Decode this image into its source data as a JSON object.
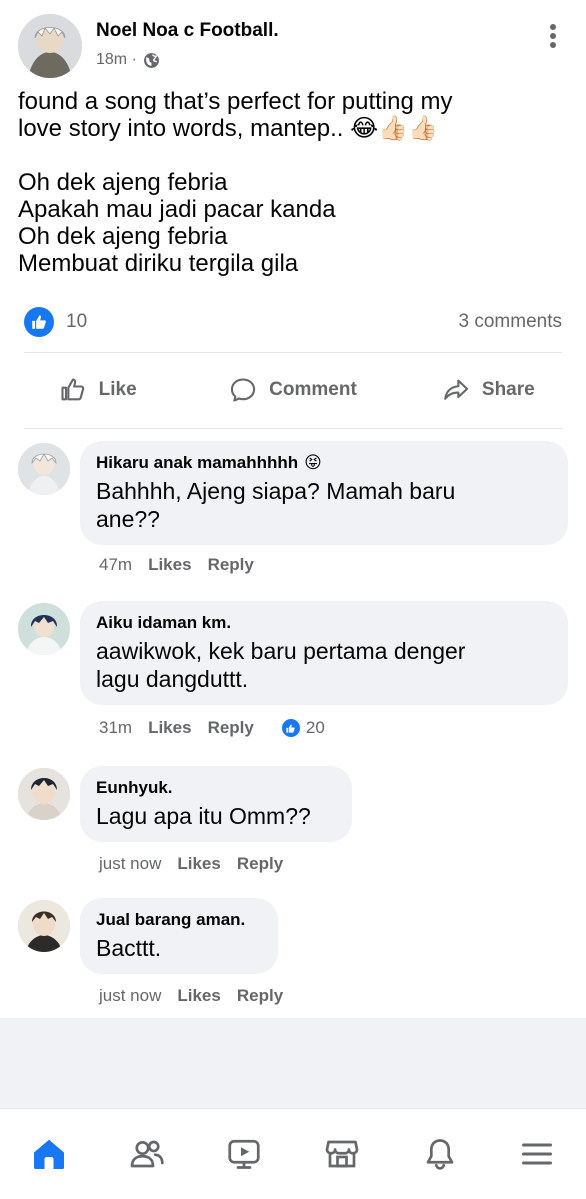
{
  "post": {
    "author": "Noel Noa c  Football.",
    "time": "18m ·",
    "visibility_icon": "globe-icon",
    "lines": [
      "found a song that’s perfect for putting my",
      "love story into words, mantep.. 😂👍🏻👍🏻",
      "",
      "Oh dek ajeng febria",
      "Apakah mau jadi pacar kanda",
      "Oh dek ajeng febria",
      "Membuat diriku tergila gila"
    ],
    "reaction_count": "10",
    "comment_count": "3 comments"
  },
  "actions": {
    "like": "Like",
    "comment": "Comment",
    "share": "Share"
  },
  "comments": [
    {
      "name": "Hikaru anak mamahhhhh",
      "emoji": "😝",
      "lines": [
        "Bahhhh, Ajeng siapa? Mamah baru",
        "ane??"
      ],
      "time": "47m",
      "likes": "Likes",
      "reply": "Reply",
      "reactions": ""
    },
    {
      "name": "Aiku idaman km.",
      "emoji": "",
      "lines": [
        "aawikwok, kek baru pertama denger",
        "lagu dangduttt."
      ],
      "time": "31m",
      "likes": "Likes",
      "reply": "Reply",
      "reactions": "20"
    },
    {
      "name": "Eunhyuk.",
      "emoji": "",
      "lines": [
        "Lagu apa itu Omm??"
      ],
      "time": "just now",
      "likes": "Likes",
      "reply": "Reply",
      "reactions": ""
    },
    {
      "name": "Jual barang aman.",
      "emoji": "",
      "lines": [
        "Bacttt."
      ],
      "time": "just now",
      "likes": "Likes",
      "reply": "Reply",
      "reactions": ""
    }
  ],
  "nav": [
    "home-icon",
    "friends-icon",
    "video-icon",
    "marketplace-icon",
    "notifications-icon",
    "menu-icon"
  ],
  "colors": {
    "accent": "#1877f2",
    "muted": "#65676b",
    "bubble": "#f0f2f5"
  }
}
